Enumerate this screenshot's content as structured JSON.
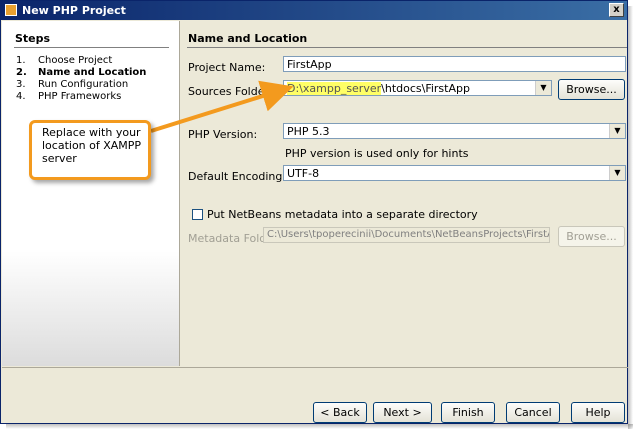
{
  "window": {
    "title": "New PHP Project",
    "close_label": "x"
  },
  "steps": {
    "header": "Steps",
    "items": [
      {
        "num": "1.",
        "label": "Choose Project"
      },
      {
        "num": "2.",
        "label": "Name and Location"
      },
      {
        "num": "3.",
        "label": "Run Configuration"
      },
      {
        "num": "4.",
        "label": "PHP Frameworks"
      }
    ],
    "current_index": 1
  },
  "panel": {
    "header": "Name and Location",
    "project_name": {
      "label": "Project Name:",
      "value": "FirstApp"
    },
    "sources_folder": {
      "label": "Sources Folder:",
      "value_highlight": "D:\\xampp_server",
      "value_rest": "\\htdocs\\FirstApp",
      "browse_label": "Browse..."
    },
    "php_version": {
      "label": "PHP Version:",
      "value": "PHP 5.3",
      "hint": "PHP version is used only for hints"
    },
    "encoding": {
      "label": "Default Encoding:",
      "value": "UTF-8"
    },
    "metadata_checkbox": {
      "label": "Put NetBeans metadata into a separate directory",
      "checked": false
    },
    "metadata_folder": {
      "label": "Metadata Folder:",
      "value": "C:\\Users\\tpoperecinii\\Documents\\NetBeansProjects\\FirstApp",
      "browse_label": "Browse..."
    }
  },
  "footer": {
    "back": "< Back",
    "next": "Next >",
    "finish": "Finish",
    "cancel": "Cancel",
    "help": "Help"
  },
  "callout": {
    "text": "Replace with your location of XAMPP server"
  },
  "colors": {
    "callout_border": "#f39a1e",
    "highlight": "#ffff66",
    "title_bar": "#0a246a"
  },
  "icons": {
    "app": "netbeans-icon",
    "close": "close-icon",
    "dropdown": "chevron-down-icon"
  }
}
